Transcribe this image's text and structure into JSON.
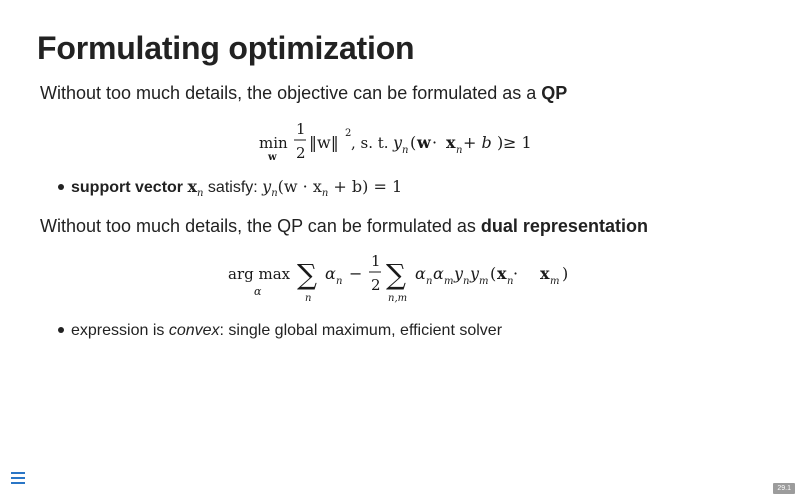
{
  "slide": {
    "title": "Formulating optimization",
    "para1": {
      "text": "Without too much details, the objective can be formulated as a ",
      "bold": "QP"
    },
    "equation1": {
      "min_label": "min",
      "min_sub": "w",
      "frac_num": "1",
      "frac_den": "2",
      "norm_body": "‖w‖",
      "norm_exp": "2",
      "st": ", s. t. ",
      "constraint_y": "y",
      "constraint_sub": "n",
      "constraint_body_open": "(",
      "w": "w",
      "dot": " · ",
      "x": "x",
      "x_sub": "n",
      "plus_b": " + b",
      "constraint_close": ")",
      "geq": " ≥ 1"
    },
    "bullet1": {
      "bold": "support vector",
      "x": "x",
      "x_sub": "n",
      "after": " satisfy: ",
      "eq_y": "y",
      "eq_y_sub": "n",
      "eq_mid": "(w · x",
      "eq_x_sub": "n",
      "eq_end": " + b) = 1"
    },
    "para2": {
      "text": "Without too much details, the QP can be formulated as ",
      "bold": "dual representation"
    },
    "equation2": {
      "argmax": "arg max",
      "alpha_sub": "α",
      "sum": "∑",
      "sum1_sub": "n",
      "alpha_n": "α",
      "alpha_n_sub": "n",
      "minus": "−",
      "frac_num": "1",
      "frac_den": "2",
      "sum2_sub": "n,m",
      "term": "α",
      "t_sub1": "n",
      "t_a2": "α",
      "t_sub2": "m",
      "t_y1": "y",
      "t_sub3": "n",
      "t_y2": "y",
      "t_sub4": "m",
      "t_open": "(",
      "t_x1": "x",
      "t_sub5": "n",
      "t_dot": " · ",
      "t_x2": "x",
      "t_sub6": "m",
      "t_close": ")"
    },
    "bullet2": {
      "before": "expression is ",
      "italic": "convex",
      "after": ": single global maximum, efficient solver"
    },
    "page_number": "29.1"
  },
  "colors": {
    "menu_icon": "#2a76c6",
    "page_badge": "#9c9c9c"
  },
  "icons": {
    "menu": "hamburger-menu-icon"
  }
}
